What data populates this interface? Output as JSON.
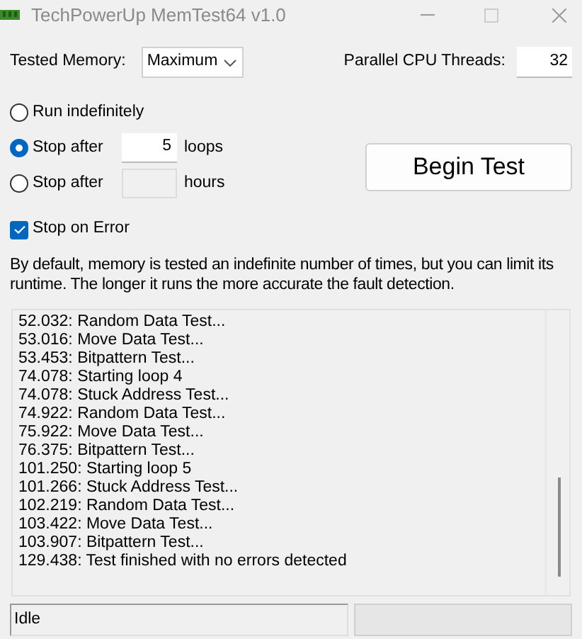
{
  "window": {
    "title": "TechPowerUp MemTest64 v1.0"
  },
  "tested_memory": {
    "label": "Tested Memory:",
    "value": "Maximum"
  },
  "threads": {
    "label": "Parallel CPU Threads:",
    "value": "32"
  },
  "run_modes": [
    {
      "label": "Run indefinitely",
      "selected": false
    },
    {
      "label": "Stop after",
      "selected": true,
      "value": "5",
      "unit": "loops",
      "disabled": false
    },
    {
      "label": "Stop after",
      "selected": false,
      "unit": "hours",
      "disabled": true
    }
  ],
  "begin_button": "Begin Test",
  "stop_on_error": {
    "label": "Stop on Error",
    "checked": true
  },
  "description": "By default, memory is tested an indefinite number of times, but you can limit its runtime. The longer it runs the more accurate the fault detection.",
  "log": [
    "52.032: Random Data Test...",
    "53.016: Move Data Test...",
    "53.453: Bitpattern Test...",
    "74.078: Starting loop 4",
    "74.078: Stuck Address Test...",
    "74.922: Random Data Test...",
    "75.922: Move Data Test...",
    "76.375: Bitpattern Test...",
    "101.250: Starting loop 5",
    "101.266: Stuck Address Test...",
    "102.219: Random Data Test...",
    "103.422: Move Data Test...",
    "103.907: Bitpattern Test...",
    "129.438: Test finished with no errors detected"
  ],
  "status_bar": {
    "text": "Idle",
    "progress": {
      "level": 0
    }
  }
}
